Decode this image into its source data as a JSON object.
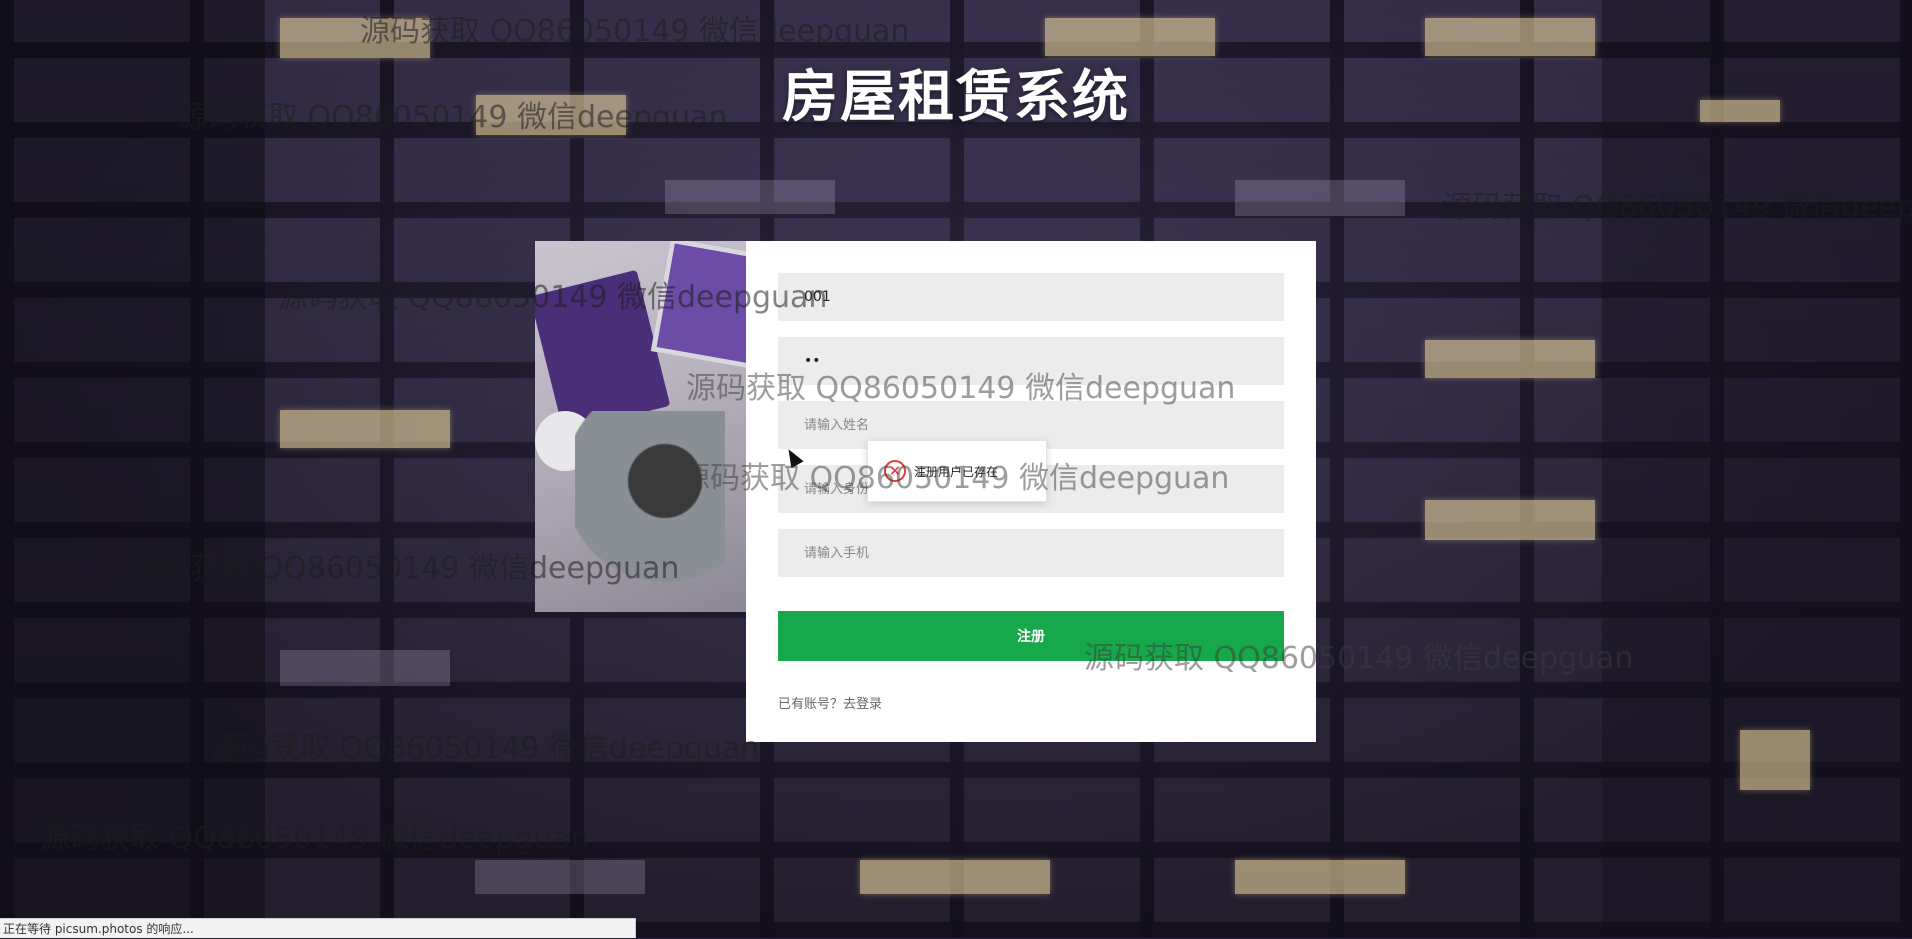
{
  "page": {
    "title": "房屋租赁系统"
  },
  "form": {
    "account_value": "001",
    "password_value": "••",
    "name_placeholder": "请输入姓名",
    "idcard_placeholder": "请输入身份证",
    "phone_placeholder": "请输入手机",
    "register_label": "注册",
    "login_link": "已有账号？去登录"
  },
  "toast": {
    "message": "注册用户已存在",
    "icon": "error-circle-icon"
  },
  "watermark": {
    "text": "源码获取 QQ86050149 微信deepguan"
  },
  "statusbar": {
    "text": "正在等待 picsum.photos 的响应..."
  },
  "colors": {
    "register_button": "#16a84a",
    "field_background": "#ececec",
    "error": "#e63b3b"
  }
}
